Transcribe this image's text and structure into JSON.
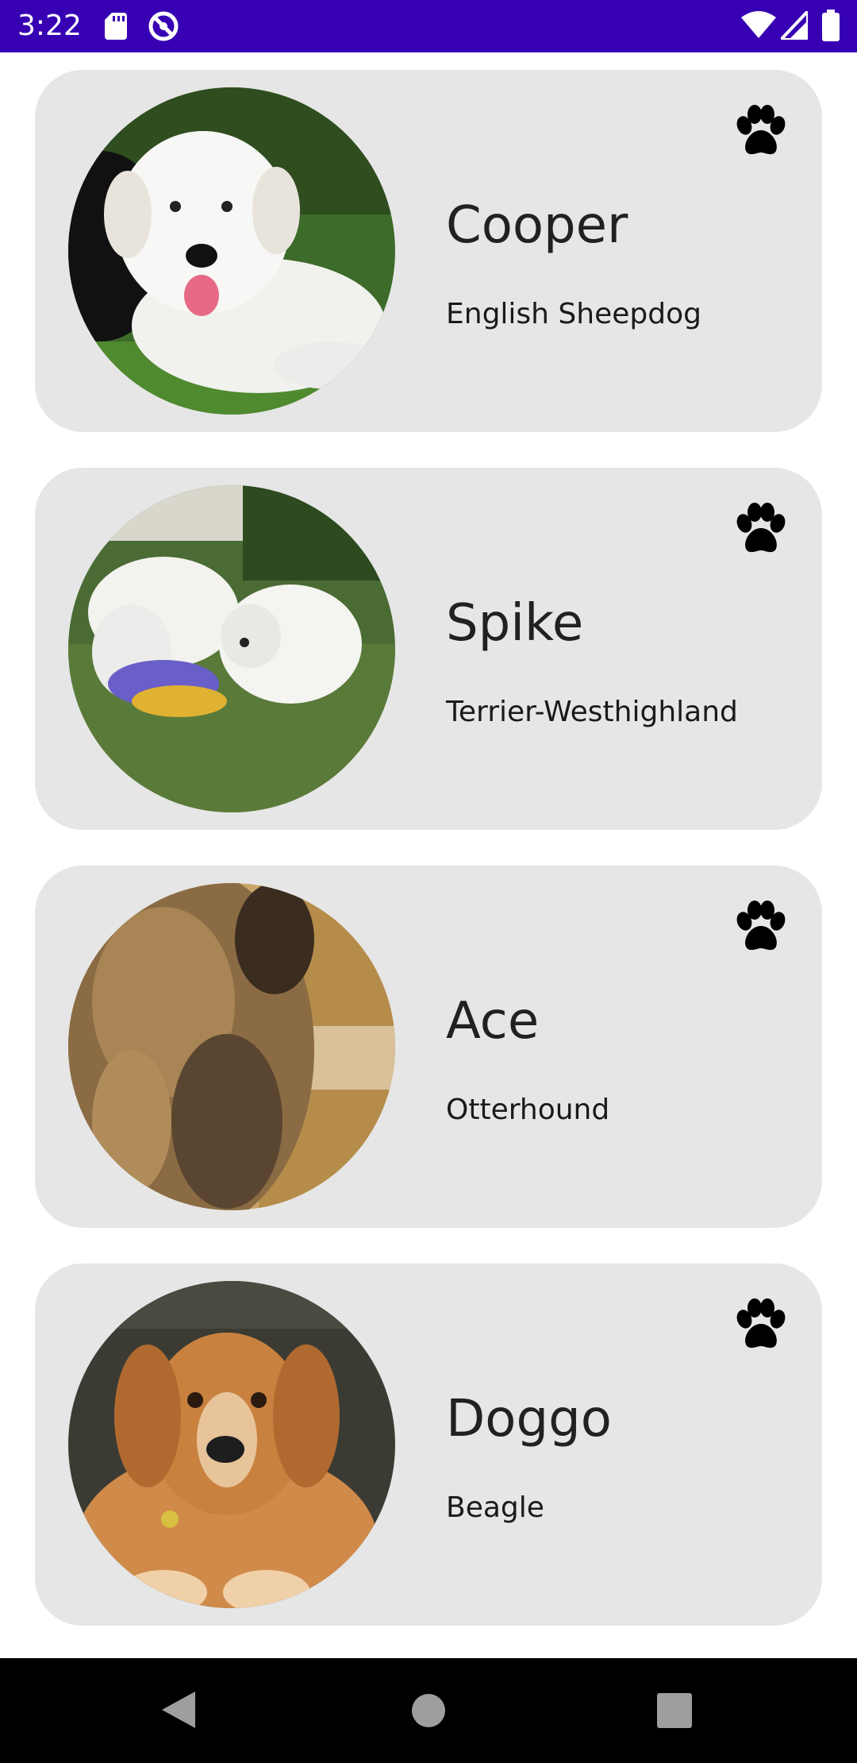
{
  "status_bar": {
    "time": "3:22",
    "left_icons": [
      "sd-card-icon",
      "sync-icon"
    ],
    "right_icons": [
      "wifi-icon",
      "cell-signal-icon",
      "battery-icon"
    ]
  },
  "dogs": [
    {
      "name": "Cooper",
      "breed": "English Sheepdog",
      "photo": "white fluffy puppy on grass",
      "icon": "paw-icon"
    },
    {
      "name": "Spike",
      "breed": "Terrier-Westhighland",
      "photo": "two white terriers playing on grass",
      "icon": "paw-icon"
    },
    {
      "name": "Ace",
      "breed": "Otterhound",
      "photo": "shaggy brown dog close-up",
      "icon": "paw-icon"
    },
    {
      "name": "Doggo",
      "breed": "Beagle",
      "photo": "brown dog portrait",
      "icon": "paw-icon"
    }
  ],
  "nav_bar": {
    "buttons": [
      "back-icon",
      "home-icon",
      "recents-icon"
    ]
  },
  "colors": {
    "status_bar": "#3700b3",
    "card_background": "#e6e6e6",
    "nav_bar": "#000000",
    "text": "#212121"
  }
}
